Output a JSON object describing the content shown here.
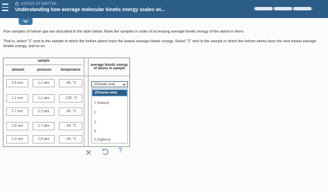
{
  "header": {
    "topic": "STATES OF MATTER",
    "title": "Understanding how average molecular kinetic energy scales wi..."
  },
  "progress": {
    "segments_total": 3,
    "segments_filled": 3
  },
  "instructions": {
    "p1": "Five samples of helium gas are described in the table below. Rank the samples in order of increasing average kinetic energy of the atoms in them.",
    "p2": "That is, select \"1\" next to the sample in which the helium atoms have the lowest average kinetic energy. Select \"2\" next to the sample in which the helium atoms have the next lowest average kinetic energy, and so on."
  },
  "table": {
    "group_header": "sample",
    "rank_header": "average kinetic energy of atoms in sample",
    "columns": [
      "amount",
      "pressure",
      "temperature"
    ],
    "rows": [
      {
        "amount": "3.6 mol",
        "pressure": "1.2 atm",
        "temperature": "- 85. °C"
      },
      {
        "amount": "1.1 mol",
        "pressure": "1.1 atm",
        "temperature": "- 100. °C"
      },
      {
        "amount": "2.7 mol",
        "pressure": "2.3 atm",
        "temperature": "- 86. °C"
      },
      {
        "amount": "1.8 mol",
        "pressure": "1.7 atm",
        "temperature": "- 84. °C"
      },
      {
        "amount": "2.0 mol",
        "pressure": "1.8 atm",
        "temperature": "- 90. °C"
      }
    ]
  },
  "select": {
    "value": "(Choose one)",
    "options": [
      "(Choose one)",
      "1 (lowest)",
      "2",
      "3",
      "4",
      "5 (highest)"
    ]
  },
  "actions": {
    "help": "?"
  },
  "colors": {
    "header_bg": "#2c5d88",
    "accent": "#2f6ea6"
  },
  "icons": [
    "menu-icon",
    "chevron-down-icon",
    "close-icon",
    "undo-icon"
  ]
}
